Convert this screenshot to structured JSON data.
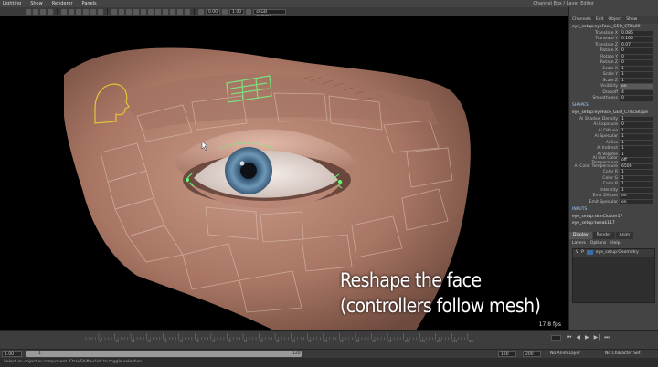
{
  "menubar": {
    "items": [
      "Lighting",
      "Show",
      "Renderer",
      "Panels"
    ],
    "channel_box_title": "Channel Box / Layer Editor"
  },
  "toolbar": {
    "value_a": "0.00",
    "value_b": "1.00",
    "colorspace": "sRGB gamma"
  },
  "viewport": {
    "fps": "17.8 fps",
    "caption_line1": "Reshape the face",
    "caption_line2": "(controllers follow mesh)"
  },
  "channel_box": {
    "menu": [
      "Channels",
      "Edit",
      "Object",
      "Show"
    ],
    "object_name": "eye_setup:eyeFace_GEO_CTRL09",
    "transform_attrs": [
      {
        "label": "Translate X",
        "value": "0.086"
      },
      {
        "label": "Translate Y",
        "value": "0.165"
      },
      {
        "label": "Translate Z",
        "value": "0.07"
      },
      {
        "label": "Rotate X",
        "value": "0"
      },
      {
        "label": "Rotate Y",
        "value": "0"
      },
      {
        "label": "Rotate Z",
        "value": "0"
      },
      {
        "label": "Scale X",
        "value": "1"
      },
      {
        "label": "Scale Y",
        "value": "1"
      },
      {
        "label": "Scale Z",
        "value": "1"
      },
      {
        "label": "Visibility",
        "value": "on"
      },
      {
        "label": "Dropoff",
        "value": "4"
      },
      {
        "label": "Smoothness",
        "value": "0"
      }
    ],
    "shapes_header": "SHAPES",
    "shape_name": "eye_setup:eyeFace_GEO_CTRLShape",
    "shape_attrs": [
      {
        "label": "Ai Shadow Density",
        "value": "1"
      },
      {
        "label": "Ai Exposure",
        "value": "0"
      },
      {
        "label": "Ai Diffuse",
        "value": "1"
      },
      {
        "label": "Ai Specular",
        "value": "1"
      },
      {
        "label": "Ai Sss",
        "value": "1"
      },
      {
        "label": "Ai Indirect",
        "value": "1"
      },
      {
        "label": "Ai Volume",
        "value": "1"
      },
      {
        "label": "Ai Use Color Temperature",
        "value": "off"
      },
      {
        "label": "Ai Color Temperature",
        "value": "6500"
      },
      {
        "label": "Color R",
        "value": "1"
      },
      {
        "label": "Color G",
        "value": "1"
      },
      {
        "label": "Color B",
        "value": "1"
      },
      {
        "label": "Intensity",
        "value": "1"
      },
      {
        "label": "Emit Diffuse",
        "value": "on"
      },
      {
        "label": "Emit Specular",
        "value": "on"
      }
    ],
    "inputs_header": "INPUTS",
    "inputs": [
      "eye_setup:skinCluster17",
      "eye_setup:tweak117"
    ]
  },
  "layer_editor": {
    "tabs": [
      "Display",
      "Render",
      "Anim"
    ],
    "menu": [
      "Layers",
      "Options",
      "Help"
    ],
    "layer_row": {
      "v": "V",
      "p": "P",
      "name": "eye_setup:Geometry"
    }
  },
  "timeline": {
    "tick_labels": [
      "5",
      "10",
      "15",
      "20",
      "25",
      "30",
      "35",
      "40",
      "45",
      "50",
      "55",
      "60",
      "65",
      "70",
      "75",
      "80",
      "85",
      "90",
      "95",
      "100",
      "105",
      "110",
      "115",
      "120"
    ]
  },
  "range": {
    "start": "1.00",
    "inner_start": "1",
    "inner_end": "120",
    "end": "120",
    "max_end": "200",
    "anim_layer": "No Anim Layer",
    "char_set": "No Character Set"
  },
  "command_line": "Select an object or component. Ctrl+Shift+click to toggle selection."
}
